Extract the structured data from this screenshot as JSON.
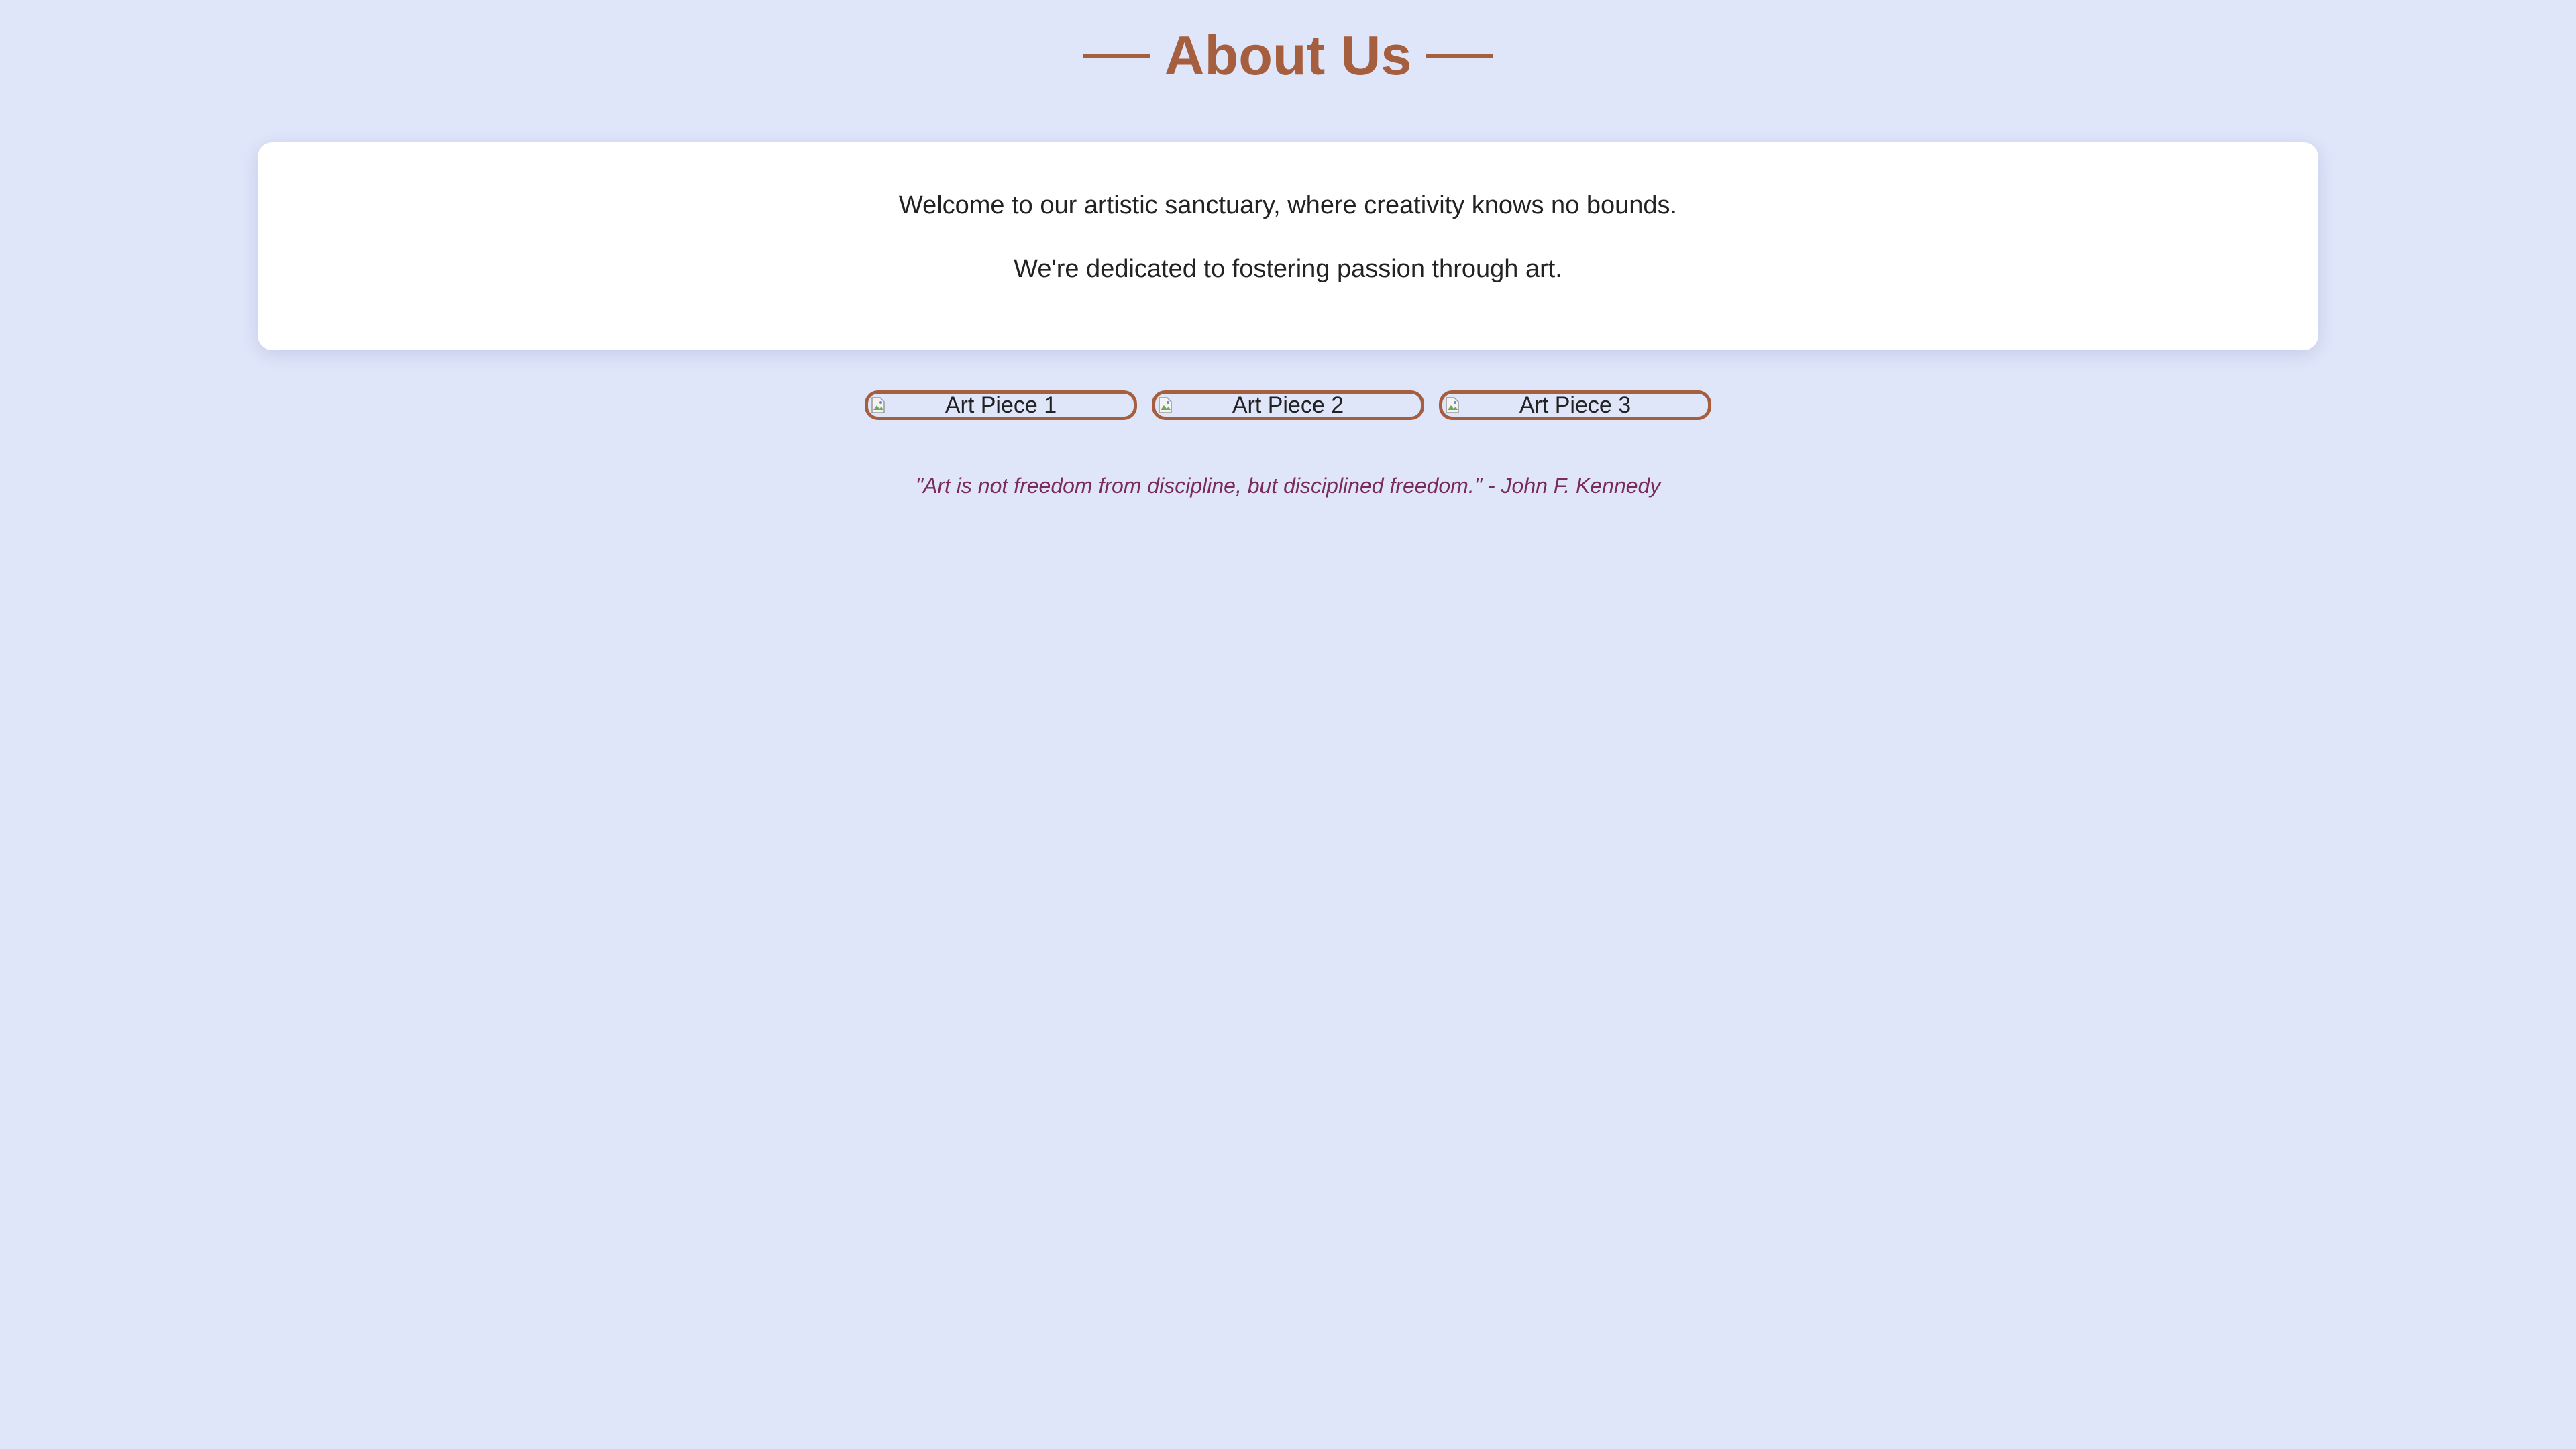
{
  "header": {
    "title": "About Us"
  },
  "intro": {
    "paragraphs": [
      "Welcome to our artistic sanctuary, where creativity knows no bounds.",
      "We're dedicated to fostering passion through art."
    ]
  },
  "gallery": {
    "items": [
      {
        "alt": "Art Piece 1",
        "icon": "broken-image-icon"
      },
      {
        "alt": "Art Piece 2",
        "icon": "broken-image-icon"
      },
      {
        "alt": "Art Piece 3",
        "icon": "broken-image-icon"
      }
    ]
  },
  "quote": {
    "text": "\"Art is not freedom from discipline, but disciplined freedom.\" - John F. Kennedy"
  },
  "colors": {
    "background": "#e0e6fa",
    "accent": "#a65f3e",
    "card": "#ffffff",
    "body_text": "#222222",
    "quote_text": "#7a2c58"
  }
}
